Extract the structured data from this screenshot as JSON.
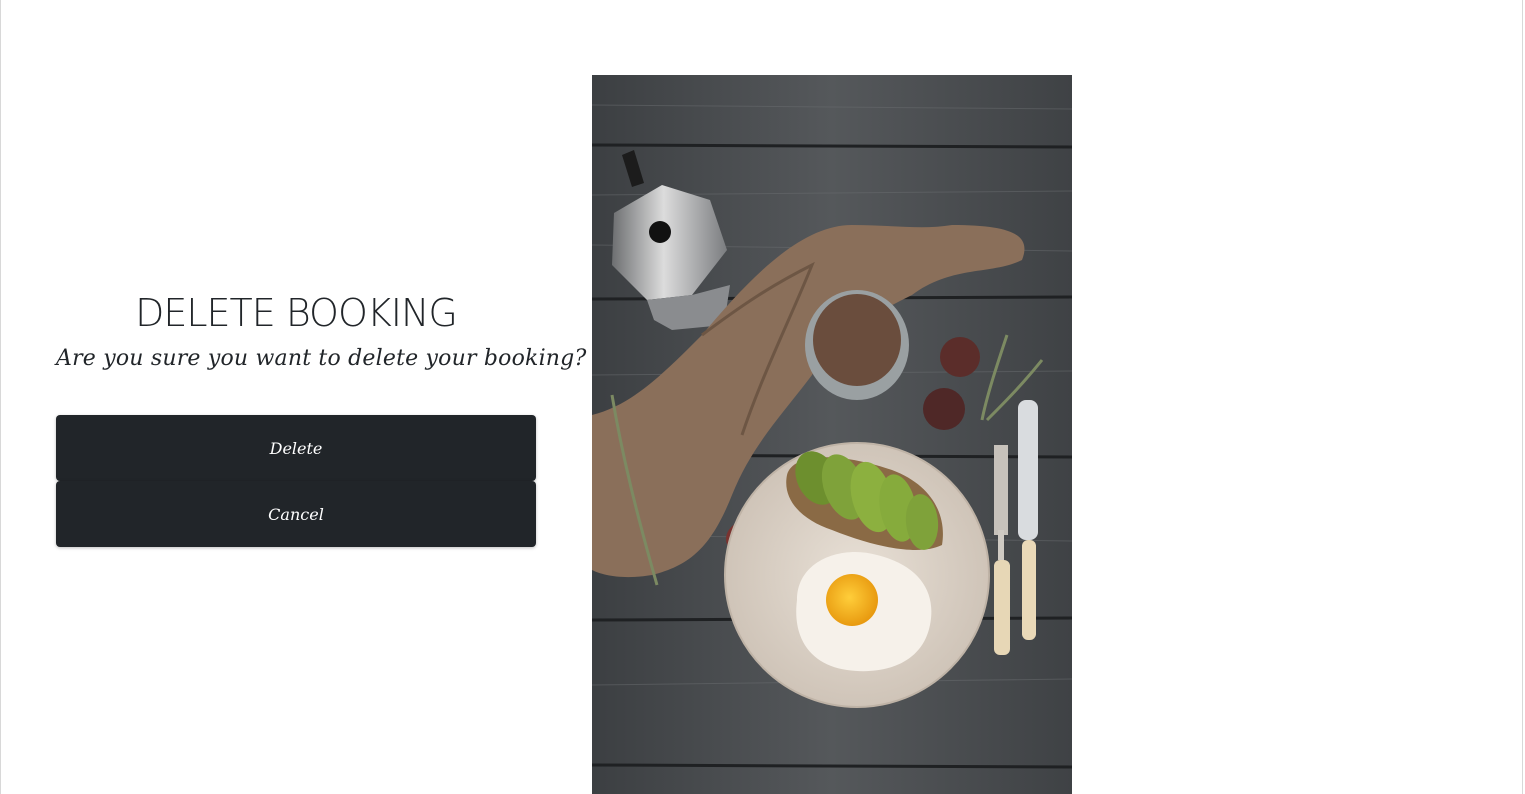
{
  "dialog": {
    "title": "DELETE BOOKING",
    "message": "Are you sure you want to delete your booking?",
    "delete_label": "Delete",
    "cancel_label": "Cancel"
  },
  "photo": {
    "subject": "breakfast-flatlay"
  },
  "colors": {
    "button_bg": "#212529",
    "button_text": "#ffffff",
    "text": "#212529"
  }
}
